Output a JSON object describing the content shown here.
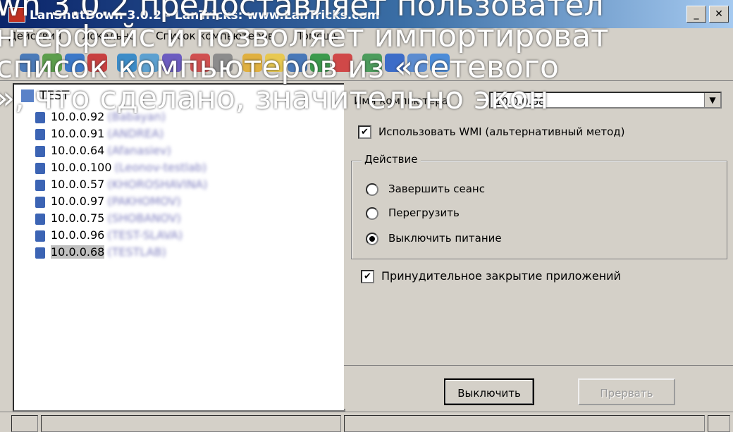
{
  "window": {
    "title": "LanShutDown 3.0.2 - LanTricks: www.LanTricks.com",
    "app_icon": "app-icon",
    "controls": [
      "minimize-icon",
      "close-icon"
    ]
  },
  "overlay_caption": {
    "lines": [
      "wn 3.0.2 предоставляет пользовател",
      "нтерфейс и позволяет импортироват",
      "список компьютеров из «сетевого",
      "», что сделано, значительно экон"
    ]
  },
  "menu": {
    "items": [
      "Действия",
      "Локально",
      "Список компьютеров",
      "Помощь"
    ]
  },
  "toolbar": {
    "icons": [
      "network-icon",
      "computer-add-icon",
      "computer-icon",
      "delete-icon",
      "refresh-icon",
      "globe-icon",
      "user-icon",
      "stop-icon",
      "settings-icon",
      "folder-icon",
      "save-icon",
      "export-icon",
      "excel-icon",
      "cancel-icon",
      "info-icon",
      "help-icon",
      "about-icon",
      "web-icon"
    ]
  },
  "tree": {
    "root_label": "TEST",
    "items": [
      {
        "ip": "10.0.0.92",
        "name": "(Babayan)"
      },
      {
        "ip": "10.0.0.91",
        "name": "(ANDREA)"
      },
      {
        "ip": "10.0.0.64",
        "name": "(Afanasiev)"
      },
      {
        "ip": "10.0.0.100",
        "name": "(Leonov-testlab)"
      },
      {
        "ip": "10.0.0.57",
        "name": "(KHOROSHAVINA)"
      },
      {
        "ip": "10.0.0.97",
        "name": "(PAKHOMOV)"
      },
      {
        "ip": "10.0.0.75",
        "name": "(SHOBANOV)"
      },
      {
        "ip": "10.0.0.96",
        "name": "(TEST-SLAVA)"
      },
      {
        "ip": "10.0.0.68",
        "name": "(TESTLAB)"
      }
    ],
    "selected_index": 8
  },
  "options": {
    "computer_name_label": "Имя компьютера",
    "computer_name_value": "10.0.0.68",
    "wmi_label": "Использовать WMI (альтернативный метод)",
    "wmi_checked": true,
    "action_group_title": "Действие",
    "actions": [
      {
        "label": "Завершить сеанс",
        "checked": false
      },
      {
        "label": "Перегрузить",
        "checked": false
      },
      {
        "label": "Выключить питание",
        "checked": true
      }
    ],
    "force_close_label": "Принудительное закрытие приложений",
    "force_close_checked": true
  },
  "buttons": {
    "shutdown_label": "Выключить",
    "abort_label": "Прервать"
  },
  "colors": {
    "window_bg": "#d4d0c8",
    "title_start": "#0a246a",
    "title_end": "#a6caf0",
    "overlay_text": "#ffffff"
  }
}
